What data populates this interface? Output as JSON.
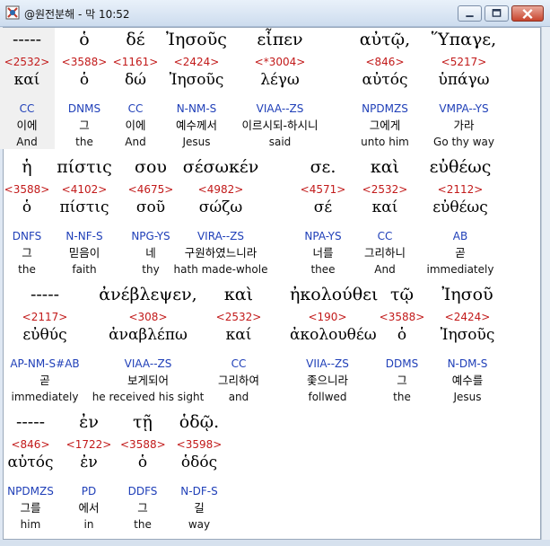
{
  "window": {
    "title": "@원전분해 - 막 10:52",
    "buttons": {
      "minimize": "minimize-icon",
      "maximize": "maximize-icon",
      "close": "close-icon"
    }
  },
  "rows": [
    {
      "words": [
        {
          "greek": "-----",
          "strong": "<2532>",
          "lemma": "καί",
          "morph": "CC",
          "korean": "이에",
          "english": "And",
          "highlight": true
        },
        {
          "greek": "ὁ",
          "strong": "<3588>",
          "lemma": "ὁ",
          "morph": "DNMS",
          "korean": "그",
          "english": "the"
        },
        {
          "greek": "δέ",
          "strong": "<1161>",
          "lemma": "δώ",
          "morph": "CC",
          "korean": "이에",
          "english": "And"
        },
        {
          "greek": "Ἰησοῦς",
          "strong": "<2424>",
          "lemma": "Ἰησοῦς",
          "morph": "N-NM-S",
          "korean": "예수께서",
          "english": "Jesus"
        },
        {
          "greek": "εἶπεν",
          "strong": "<*3004>",
          "lemma": "λέγω",
          "morph": "VIAA--ZS",
          "korean": "이르시되-하시니",
          "english": "said"
        },
        {
          "greek": "αὐτῷ,",
          "strong": "<846>",
          "lemma": "αὐτός",
          "morph": "NPDMZS",
          "korean": "그에게",
          "english": "unto him"
        },
        {
          "greek": "Ὕπαγε,",
          "strong": "<5217>",
          "lemma": "ὑπάγω",
          "morph": "VMPA--YS",
          "korean": "가라",
          "english": "Go thy way"
        }
      ]
    },
    {
      "words": [
        {
          "greek": "ἡ",
          "strong": "<3588>",
          "lemma": "ὁ",
          "morph": "DNFS",
          "korean": "그",
          "english": "the"
        },
        {
          "greek": "πίστις",
          "strong": "<4102>",
          "lemma": "πίστις",
          "morph": "N-NF-S",
          "korean": "믿음이",
          "english": "faith"
        },
        {
          "greek": "σου",
          "strong": "<4675>",
          "lemma": "σοῦ",
          "morph": "NPG-YS",
          "korean": "네",
          "english": "thy"
        },
        {
          "greek": "σέσωκέν",
          "strong": "<4982>",
          "lemma": "σώζω",
          "morph": "VIRA--ZS",
          "korean": "구원하였느니라",
          "english": "hath made-whole"
        },
        {
          "greek": "σε.",
          "strong": "<4571>",
          "lemma": "σέ",
          "morph": "NPA-YS",
          "korean": "너를",
          "english": "thee"
        },
        {
          "greek": "καὶ",
          "strong": "<2532>",
          "lemma": "καί",
          "morph": "CC",
          "korean": "그리하니",
          "english": "And"
        },
        {
          "greek": "εὐθέως",
          "strong": "<2112>",
          "lemma": "εὐθέως",
          "morph": "AB",
          "korean": "곧",
          "english": "immediately"
        }
      ]
    },
    {
      "words": [
        {
          "greek": "-----",
          "strong": "<2117>",
          "lemma": "εὐθύς",
          "morph": "AP-NM-S#AB",
          "korean": "곧",
          "english": "immediately"
        },
        {
          "greek": "ἀνέβλεψεν,",
          "strong": "<308>",
          "lemma": "ἀναβλέπω",
          "morph": "VIAA--ZS",
          "korean": "보게되어",
          "english": "he received his sight"
        },
        {
          "greek": "καὶ",
          "strong": "<2532>",
          "lemma": "καί",
          "morph": "CC",
          "korean": "그리하여",
          "english": "and"
        },
        {
          "greek": "ἠκολούθει",
          "strong": "<190>",
          "lemma": "ἀκολουθέω",
          "morph": "VIIA--ZS",
          "korean": "좇으니라",
          "english": "follwed"
        },
        {
          "greek": "τῷ",
          "strong": "<3588>",
          "lemma": "ὁ",
          "morph": "DDMS",
          "korean": "그",
          "english": "the"
        },
        {
          "greek": "Ἰησοῦ",
          "strong": "<2424>",
          "lemma": "Ἰησοῦς",
          "morph": "N-DM-S",
          "korean": "예수를",
          "english": "Jesus"
        }
      ]
    },
    {
      "words": [
        {
          "greek": "-----",
          "strong": "<846>",
          "lemma": "αὐτός",
          "morph": "NPDMZS",
          "korean": "그를",
          "english": "him"
        },
        {
          "greek": "ἐν",
          "strong": "<1722>",
          "lemma": "ἐν",
          "morph": "PD",
          "korean": "에서",
          "english": "in"
        },
        {
          "greek": "τῇ",
          "strong": "<3588>",
          "lemma": "ὁ",
          "morph": "DDFS",
          "korean": "그",
          "english": "the"
        },
        {
          "greek": "ὁδῷ.",
          "strong": "<3598>",
          "lemma": "ὁδός",
          "morph": "N-DF-S",
          "korean": "길",
          "english": "way"
        }
      ]
    }
  ]
}
